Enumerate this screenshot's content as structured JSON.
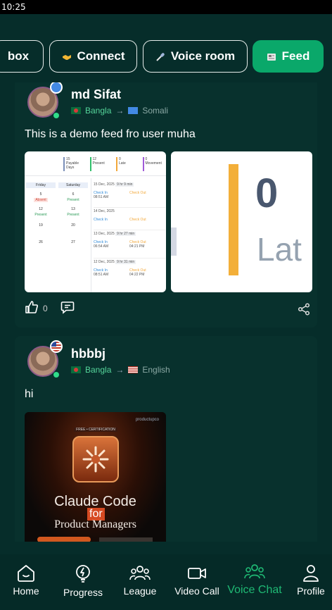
{
  "status_bar": {
    "time": "10:25"
  },
  "tabs": [
    {
      "label": "box",
      "active": false
    },
    {
      "label": "Connect",
      "icon": "handshake-icon",
      "active": false
    },
    {
      "label": "Voice room",
      "icon": "microphone-icon",
      "active": false
    },
    {
      "label": "Feed",
      "icon": "newspaper-icon",
      "active": true
    }
  ],
  "posts": [
    {
      "username": "md Sifat",
      "lang_from": "Bangla",
      "lang_to": "Somali",
      "text": "This is a demo feed  fro user muha",
      "likes": "0",
      "attendance": {
        "stats": [
          {
            "num": "15",
            "label": "Payable Days"
          },
          {
            "num": "12",
            "label": "Present"
          },
          {
            "num": "0",
            "label": "Late"
          },
          {
            "num": "0",
            "label": "Movement"
          }
        ],
        "cal_headers": [
          "Friday",
          "Saturday"
        ],
        "cal_rows": [
          [
            "5",
            "6"
          ],
          [
            "Absent",
            "Present"
          ],
          [
            "12",
            "13"
          ],
          [
            "Present",
            "Present"
          ],
          [
            "19",
            "20"
          ],
          [
            "26",
            "27"
          ]
        ],
        "entries": [
          {
            "date": "15 Dec, 2025",
            "hours": "9 hr 9 min",
            "in_label": "Check In",
            "in_time": "08:51 AM",
            "out_label": "Check Out",
            "out_time": ""
          },
          {
            "date": "14 Dec, 2025",
            "hours": "",
            "in_label": "Check In",
            "in_time": "",
            "out_label": "Check Out",
            "out_time": ""
          },
          {
            "date": "13 Dec, 2025",
            "hours": "9 hr 27 min",
            "in_label": "Check In",
            "in_time": "06:54 AM",
            "out_label": "Check Out",
            "out_time": "04:21 PM"
          },
          {
            "date": "12 Dec, 2025",
            "hours": "9 hr 31 min",
            "in_label": "Check In",
            "in_time": "08:51 AM",
            "out_label": "Check Out",
            "out_time": "04:22 PM"
          }
        ]
      },
      "zoom_image": {
        "value": "0",
        "word": "Lat"
      }
    },
    {
      "username": "hbbbj",
      "lang_from": "Bangla",
      "lang_to": "English",
      "text": "hi",
      "promo": {
        "brand": "productupco",
        "tag": "FREE • CERTIFICATION",
        "title": "Claude Code",
        "for": "for",
        "subtitle": "Product Managers"
      }
    }
  ],
  "nav": [
    {
      "label": "Home",
      "icon": "home-icon",
      "active": false
    },
    {
      "label": "Progress",
      "icon": "progress-bolt-icon",
      "active": false
    },
    {
      "label": "League",
      "icon": "league-group-icon",
      "active": false
    },
    {
      "label": "Video Call",
      "icon": "video-camera-icon",
      "active": false
    },
    {
      "label": "Voice Chat",
      "icon": "voice-chat-icon",
      "active": true
    },
    {
      "label": "Profile",
      "icon": "profile-icon",
      "active": false
    }
  ],
  "colors": {
    "background": "#062d2a",
    "card": "#08312d",
    "accent": "#0aa86a",
    "active_nav": "#1fb974"
  }
}
